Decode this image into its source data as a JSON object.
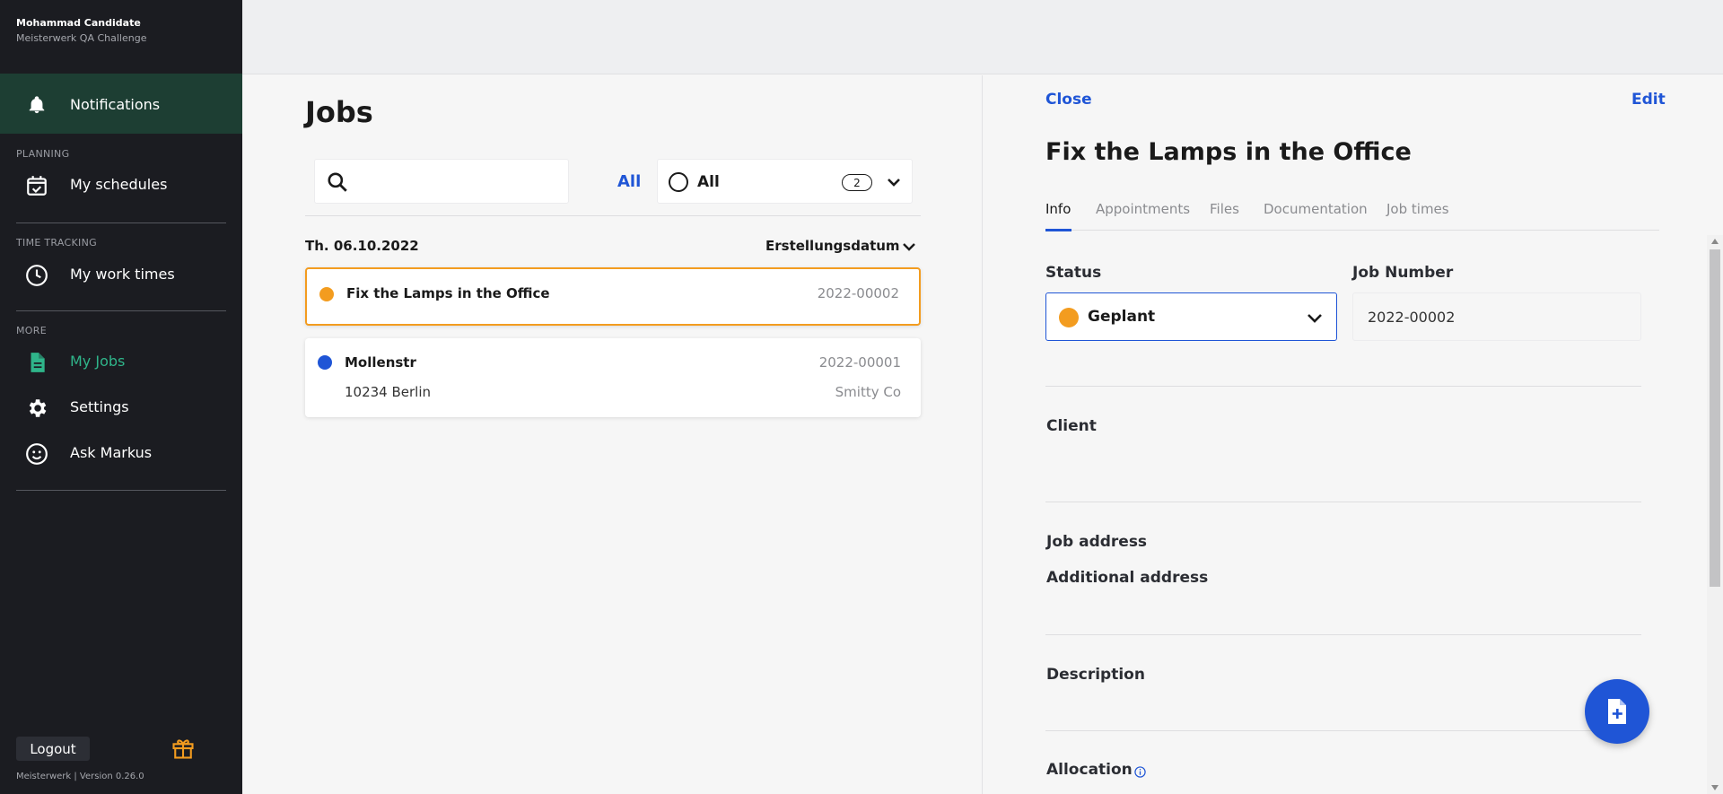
{
  "user": {
    "name": "Mohammad Candidate",
    "org": "Meisterwerk QA Challenge"
  },
  "sidebar": {
    "notifications_label": "Notifications",
    "sections": {
      "planning": "PLANNING",
      "time_tracking": "TIME TRACKING",
      "more": "MORE"
    },
    "items": {
      "my_schedules": "My schedules",
      "my_work_times": "My work times",
      "my_jobs": "My Jobs",
      "settings": "Settings",
      "ask_markus": "Ask Markus"
    },
    "logout_label": "Logout",
    "version": "Meisterwerk | Version 0.26.0"
  },
  "jobs": {
    "title": "Jobs",
    "search": {
      "value": "",
      "placeholder": ""
    },
    "all_link": "All",
    "filter": {
      "label": "All",
      "count": "2"
    },
    "date_group": "Th. 06.10.2022",
    "sort_label": "Erstellungsdatum",
    "list": [
      {
        "name": "Fix the Lamps in the Office",
        "number": "2022-00002",
        "status_color": "#f39c1f",
        "selected": true
      },
      {
        "name": "Mollenstr",
        "number": "2022-00001",
        "address": "10234 Berlin",
        "client": "Smitty Co",
        "status_color": "#1f55d6",
        "selected": false
      }
    ]
  },
  "detail": {
    "close_label": "Close",
    "edit_label": "Edit",
    "title": "Fix the Lamps in the Office",
    "tabs": [
      "Info",
      "Appointments",
      "Files",
      "Documentation",
      "Job times"
    ],
    "active_tab": "Info",
    "status_label": "Status",
    "status_value": "Geplant",
    "job_number_label": "Job Number",
    "job_number_value": "2022-00002",
    "client_label": "Client",
    "job_address_label": "Job address",
    "additional_address_label": "Additional address",
    "description_label": "Description",
    "allocation_label": "Allocation"
  },
  "colors": {
    "accent": "#1f55d6",
    "sidebar_bg": "#1b1c21",
    "notif_bg": "#1d3e33",
    "active_green": "#2fb58a",
    "status_planned": "#f39c1f",
    "gift_orange": "#f39c1f"
  },
  "icons": [
    "bell-icon",
    "calendar-check-icon",
    "clock-icon",
    "document-icon",
    "gear-icon",
    "smiley-icon",
    "gift-icon",
    "search-icon",
    "chevron-down-icon",
    "info-icon",
    "add-document-icon"
  ]
}
